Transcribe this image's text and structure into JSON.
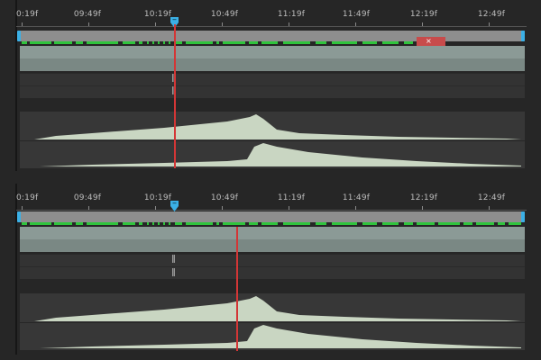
{
  "timeline_top": {
    "ruler_labels": [
      "0:19f",
      "09:49f",
      "10:19f",
      "10:49f",
      "11:19f",
      "11:49f",
      "12:19f",
      "12:49f"
    ],
    "cache_marker": "×"
  },
  "timeline_bottom": {
    "ruler_labels": [
      "0:19f",
      "09:49f",
      "10:19f",
      "10:49f",
      "11:19f",
      "11:49f",
      "12:19f",
      "12:49f"
    ]
  },
  "icons": {
    "keyframe": "keyframe-icon",
    "playhead": "playhead-icon",
    "workarea_handle": "workarea-handle-icon"
  },
  "colors": {
    "background": "#262626",
    "cache_green": "#2fc43c",
    "playhead_blue": "#3bb0e6",
    "cti_red": "#d33636",
    "waveform": "#c9d6c2",
    "video_track": "#8b9a96"
  }
}
